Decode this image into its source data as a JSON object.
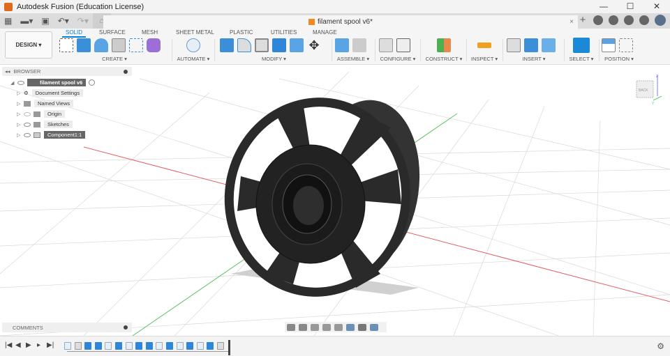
{
  "window": {
    "title": "Autodesk Fusion (Education License)",
    "minimize": "—",
    "maximize": "☐",
    "close": "✕"
  },
  "document_tab": {
    "title": "filament spool v6*",
    "close": "×"
  },
  "workspace": {
    "label": "DESIGN ▾"
  },
  "ribbon_tabs": [
    "SOLID",
    "SURFACE",
    "MESH",
    "SHEET METAL",
    "PLASTIC",
    "UTILITIES",
    "MANAGE"
  ],
  "ribbon_groups": [
    "CREATE ▾",
    "AUTOMATE ▾",
    "MODIFY ▾",
    "ASSEMBLE ▾",
    "CONFIGURE ▾",
    "CONSTRUCT ▾",
    "INSPECT ▾",
    "INSERT ▾",
    "SELECT ▾",
    "POSITION ▾"
  ],
  "browser": {
    "title": "BROWSER",
    "root": "filament spool v6",
    "items": [
      "Document Settings",
      "Named Views",
      "Origin",
      "Sketches",
      "Component1:1"
    ]
  },
  "comments": {
    "title": "COMMENTS"
  },
  "viewcube": {
    "face": "BACK",
    "axis_z": "Z",
    "axis_y": "Y"
  },
  "timeline": {
    "features": [
      "sketch",
      "revolve",
      "extrude",
      "extrude",
      "sketch",
      "extrude",
      "sketch",
      "extrude",
      "extrude",
      "sketch",
      "extrude",
      "sketch",
      "extrude",
      "sketch",
      "extrude",
      "fillet"
    ]
  },
  "colors": {
    "accent": "#0a7fd4",
    "x_axis": "#e06060",
    "y_axis": "#60c060",
    "model": "#2a2a2a"
  }
}
